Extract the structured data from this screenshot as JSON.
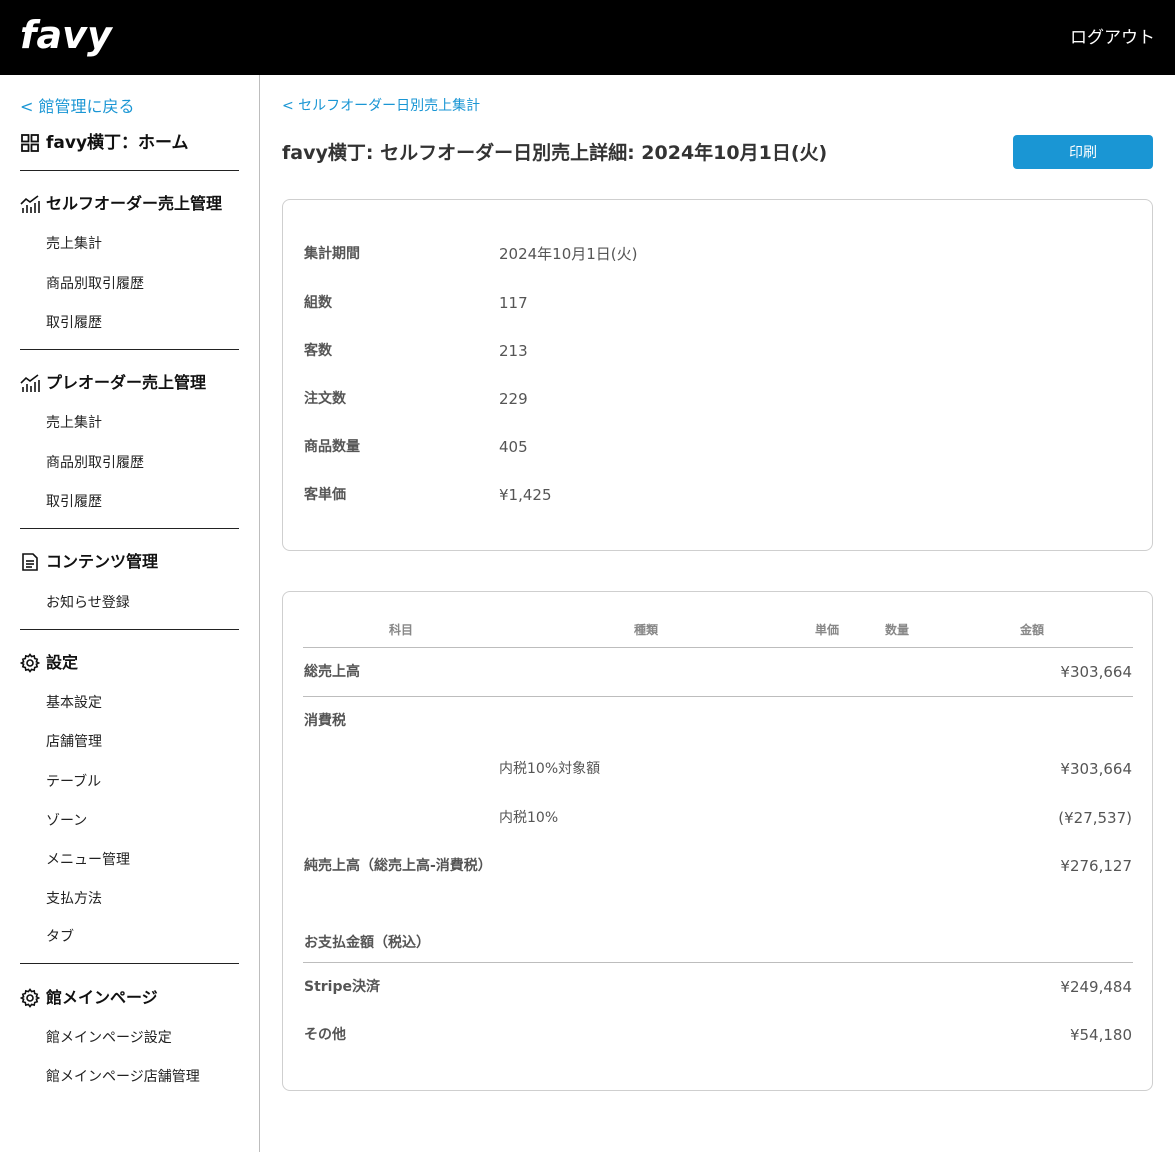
{
  "header": {
    "logo": "favy",
    "logout_label": "ログアウト"
  },
  "sidebar": {
    "back_label": "< 館管理に戻る",
    "home_label": "favy横丁：ホーム",
    "sections": [
      {
        "title": "セルフオーダー売上管理",
        "icon": "chart-icon",
        "items": [
          "売上集計",
          "商品別取引履歴",
          "取引履歴"
        ]
      },
      {
        "title": "プレオーダー売上管理",
        "icon": "chart-icon",
        "items": [
          "売上集計",
          "商品別取引履歴",
          "取引履歴"
        ]
      },
      {
        "title": "コンテンツ管理",
        "icon": "document-icon",
        "items": [
          "お知らせ登録"
        ]
      },
      {
        "title": "設定",
        "icon": "gear-icon",
        "items": [
          "基本設定",
          "店舗管理",
          "テーブル",
          "ゾーン",
          "メニュー管理",
          "支払方法",
          "タブ"
        ]
      },
      {
        "title": "館メインページ",
        "icon": "gear-icon",
        "items": [
          "館メインページ設定",
          "館メインページ店舗管理"
        ]
      }
    ]
  },
  "main": {
    "breadcrumb": "< セルフオーダー日別売上集計",
    "title": "favy横丁: セルフオーダー日別売上詳細: 2024年10月1日(火)",
    "print_label": "印刷",
    "summary": [
      {
        "label": "集計期間",
        "value": "2024年10月1日(火)"
      },
      {
        "label": "組数",
        "value": "117"
      },
      {
        "label": "客数",
        "value": "213"
      },
      {
        "label": "注文数",
        "value": "229"
      },
      {
        "label": "商品数量",
        "value": "405"
      },
      {
        "label": "客単価",
        "value": "¥1,425"
      }
    ],
    "table": {
      "headers": {
        "subject": "科目",
        "kind": "種類",
        "unit_price": "単価",
        "qty": "数量",
        "amount": "金額"
      },
      "gross_sales": {
        "label": "総売上高",
        "amount": "¥303,664"
      },
      "tax": {
        "label": "消費税"
      },
      "tax_base": {
        "kind": "内税10%対象額",
        "amount": "¥303,664"
      },
      "tax_amount": {
        "kind": "内税10%",
        "amount": "(¥27,537)"
      },
      "net_sales": {
        "label": "純売上高（総売上高-消費税）",
        "amount": "¥276,127"
      },
      "payment_title": "お支払金額（税込）",
      "stripe": {
        "label": "Stripe決済",
        "amount": "¥249,484"
      },
      "other": {
        "label": "その他",
        "amount": "¥54,180"
      }
    }
  }
}
